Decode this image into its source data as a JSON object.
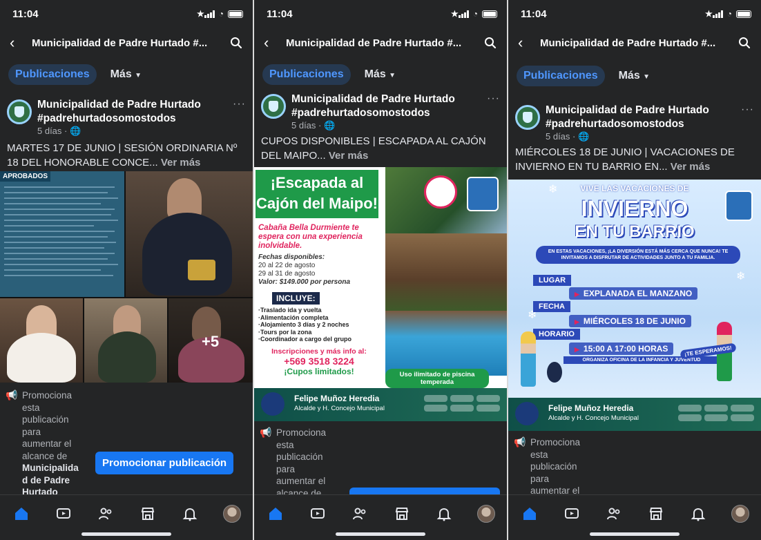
{
  "screens": [
    {
      "status_time": "11:04",
      "nav_title": "Municipalidad de Padre Hurtado #...",
      "tabs": {
        "active": "Publicaciones",
        "more": "Más"
      },
      "page_name": "Municipalidad de Padre Hurtado #padrehurtadosomostodos",
      "meta": "5 días · 🌐",
      "post_text": "MARTES 17 DE JUNIO | SESIÓN ORDINARIA Nº 18 DEL HONORABLE CONCE...",
      "see_more": "Ver más",
      "media_badge": "APROBADOS",
      "plus_count": "+5",
      "promo_words": [
        "Promociona",
        "esta",
        "publicación",
        "para",
        "aumentar el",
        "alcance de"
      ],
      "promo_bold": [
        "Municipalida",
        "d de Padre",
        "Hurtado"
      ],
      "promo_button": "Promocionar publicación"
    },
    {
      "status_time": "11:04",
      "nav_title": "Municipalidad de Padre Hurtado #...",
      "tabs": {
        "active": "Publicaciones",
        "more": "Más"
      },
      "page_name": "Municipalidad de Padre Hurtado #padrehurtadosomostodos",
      "meta": "5 días · 🌐",
      "post_text": "CUPOS DISPONIBLES | ESCAPADA AL CAJÓN DEL MAIPO...",
      "see_more": "Ver más",
      "flyer": {
        "title": "¡Escapada al Cajón del Maipo!",
        "subtitle": "Cabaña Bella Durmiente te espera con una experiencia inolvidable.",
        "fechas_label": "Fechas disponibles:",
        "fechas": [
          "20 al 22 de agosto",
          "29 al 31 de agosto"
        ],
        "valor": "Valor: $149.000 por persona",
        "incluye": "INCLUYE:",
        "items": [
          "·Traslado ida y vuelta",
          "·Alimentación completa",
          "·Alojamiento 3 días y 2 noches",
          "·Tours por la zona",
          "·Coordinador a cargo del grupo"
        ],
        "info": "Inscripciones y más info al:",
        "phone": "+569 3518 3224",
        "cupos": "¡Cupos limitados!",
        "piscina": "Uso ilimitado de piscina temperada",
        "mayor": "Felipe Muñoz Heredia",
        "role": "Alcalde y H. Concejo Municipal"
      },
      "promo_words": [
        "Promociona",
        "esta",
        "publicación",
        "para",
        "aumentar el",
        "alcance de"
      ]
    },
    {
      "status_time": "11:04",
      "nav_title": "Municipalidad de Padre Hurtado #...",
      "tabs": {
        "active": "Publicaciones",
        "more": "Más"
      },
      "page_name": "Municipalidad de Padre Hurtado #padrehurtadosomostodos",
      "meta": "5 días · 🌐",
      "post_text": "MIÉRCOLES 18 DE JUNIO | VACACIONES DE INVIERNO EN TU BARRIO EN...",
      "see_more": "Ver más",
      "flyer": {
        "vive": "VIVE LAS VACACIONES DE",
        "big": "INVIERNO",
        "barrio": "EN TU BARRIO",
        "intro": "EN ESTAS VACACIONES, ¡LA DIVERSIÓN ESTÁ MÁS CERCA QUE NUNCA! TE INVITAMOS A DISFRUTAR DE ACTIVIDADES JUNTO A TU FAMILIA.",
        "lugar_label": "LUGAR",
        "lugar": "EXPLANADA EL MANZANO",
        "fecha_label": "FECHA",
        "fecha": "MIÉRCOLES 18 DE JUNIO",
        "horario_label": "HORARIO",
        "horario": "15:00 A 17:00 HORAS",
        "org": "ORGANIZA OFICINA DE LA INFANCIA Y JUVENTUD",
        "team": "¡TE ESPERAMOS!",
        "mayor": "Felipe Muñoz Heredia",
        "role": "Alcalde y H. Concejo Municipal"
      },
      "promo_words": [
        "Promociona",
        "esta",
        "publicación",
        "para",
        "aumentar el"
      ]
    }
  ],
  "colors": {
    "bg": "#242526",
    "accent": "#1877f2",
    "tab_bg": "#263951",
    "tab_text": "#4f97ff"
  },
  "icons": [
    "back-arrow-icon",
    "search-icon",
    "globe-icon",
    "more-dots-icon",
    "megaphone-icon",
    "home-icon",
    "video-icon",
    "friends-icon",
    "marketplace-icon",
    "bell-icon",
    "profile-avatar"
  ]
}
